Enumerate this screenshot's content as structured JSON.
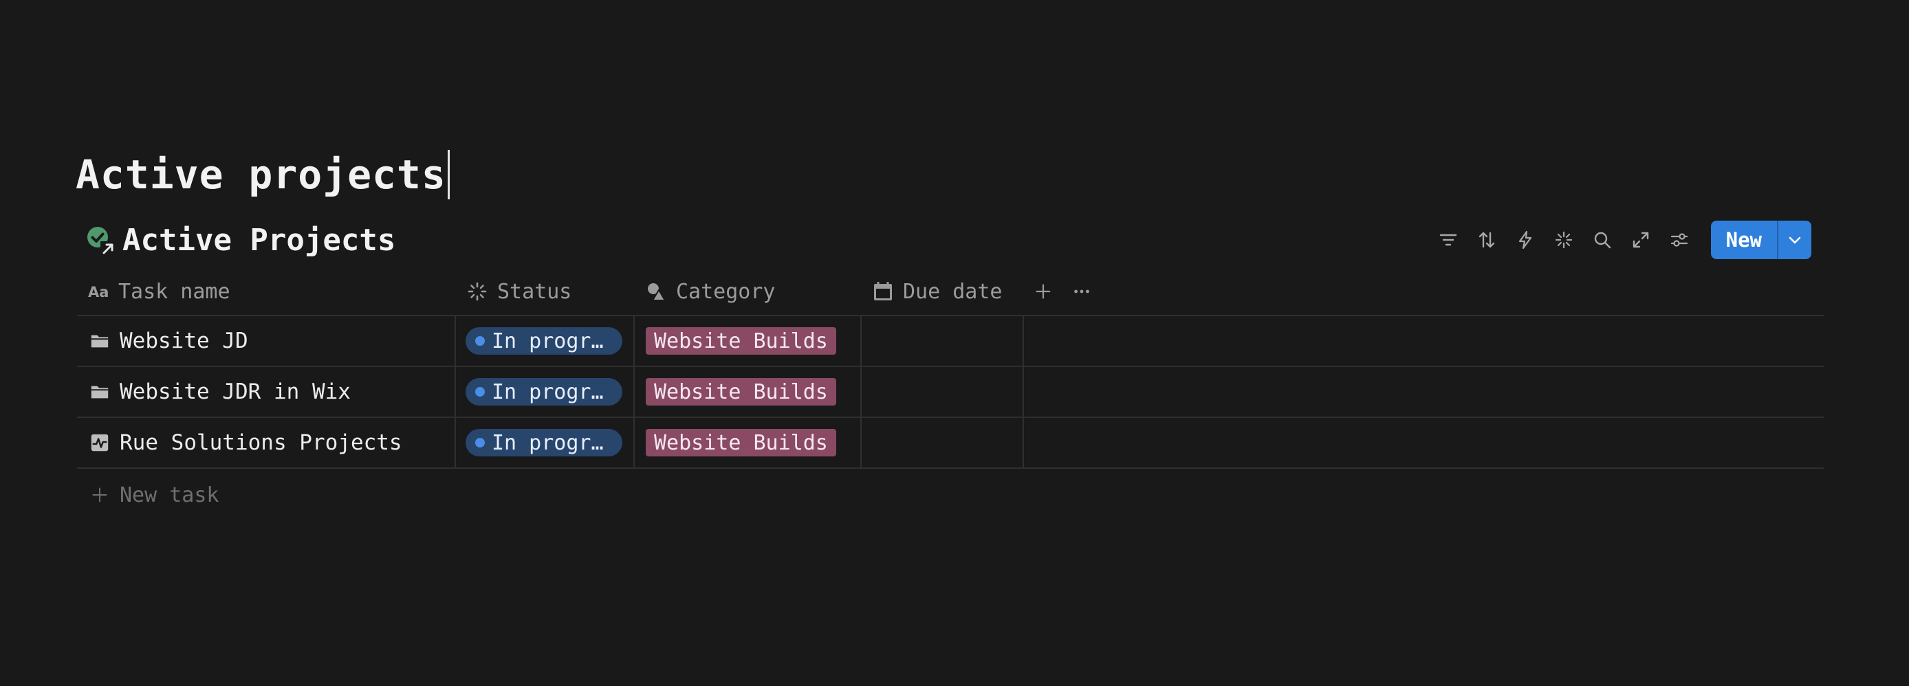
{
  "page": {
    "title": "Active projects"
  },
  "database": {
    "title": "Active Projects",
    "title_icon": "check-circle-link-icon",
    "toolbar": {
      "icons": [
        "filter-icon",
        "sort-icon",
        "lightning-icon",
        "sparkle-icon",
        "search-icon",
        "expand-icon",
        "settings-sliders-icon"
      ],
      "new_label": "New",
      "new_dropdown_icon": "chevron-down-icon"
    }
  },
  "table": {
    "columns": [
      {
        "key": "name",
        "label": "Task name",
        "icon": "text-aa-icon"
      },
      {
        "key": "status",
        "label": "Status",
        "icon": "status-spinner-icon"
      },
      {
        "key": "category",
        "label": "Category",
        "icon": "shapes-icon"
      },
      {
        "key": "due",
        "label": "Due date",
        "icon": "calendar-icon"
      }
    ],
    "rows": [
      {
        "name": "Website JD",
        "icon": "folder-icon",
        "status": "In progr…",
        "category": "Website Builds",
        "due": ""
      },
      {
        "name": "Website JDR in Wix",
        "icon": "folder-icon",
        "status": "In progr…",
        "category": "Website Builds",
        "due": ""
      },
      {
        "name": "Rue Solutions Projects",
        "icon": "activity-chart-icon",
        "status": "In progr…",
        "category": "Website Builds",
        "due": ""
      }
    ],
    "new_task_label": "New task"
  },
  "colors": {
    "background": "#191919",
    "accent_button": "#2f7fdc",
    "status_pill": "#28456c",
    "status_dot": "#4a8ee8",
    "category_tag": "#8a4a63"
  }
}
